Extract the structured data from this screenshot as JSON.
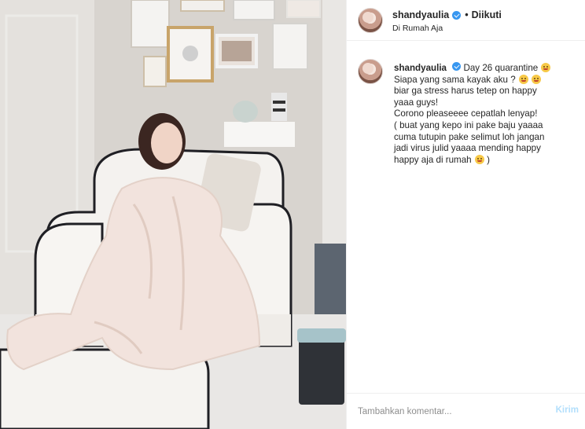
{
  "post": {
    "author": {
      "username": "shandyaulia",
      "verified": true,
      "follow_status": "Diikuti",
      "location": "Di Rumah Aja"
    },
    "caption": {
      "username": "shandyaulia",
      "lines": [
        "Day 26 quarantine",
        "Siapa yang sama kayak aku ?",
        "biar ga stress harus tetep on happy",
        "yaaa guys!",
        "Corono pleaseeee cepatlah lenyap!",
        "( buat yang kepo ini pake baju yaaaa",
        "cuma tutupin pake selimut loh jangan",
        "jadi virus julid yaaaa mending happy",
        "happy aja di rumah",
        ")"
      ]
    },
    "comment": {
      "placeholder": "Tambahkan komentar...",
      "send_label": "Kirim"
    }
  },
  "colors": {
    "verified_badge": "#3897f0",
    "send_disabled": "#b2dffc",
    "divider": "#efefef"
  },
  "icons": [
    "verified-badge-icon",
    "emoji-icon"
  ]
}
